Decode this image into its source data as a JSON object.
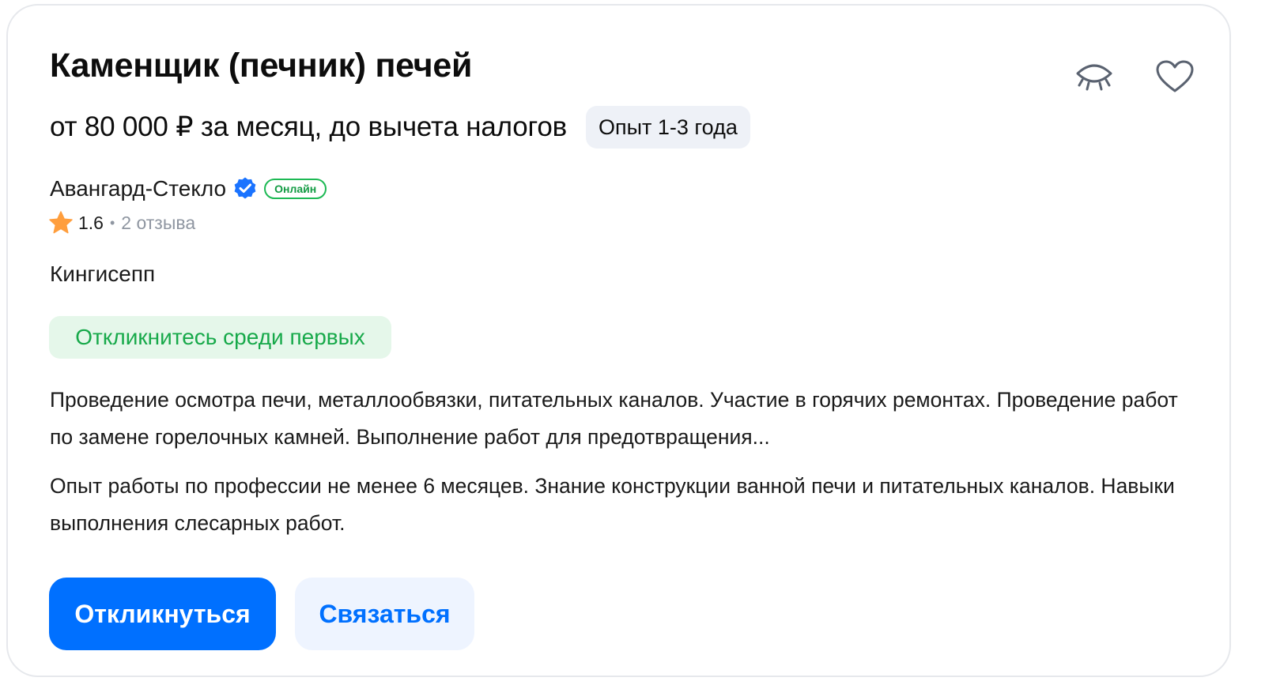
{
  "vacancy": {
    "title": "Каменщик (печник) печей",
    "salary": "от 80 000 ₽ за месяц, до вычета налогов",
    "experience_badge": "Опыт 1-3 года"
  },
  "actions": {
    "hide_icon": "eye-closed-icon",
    "favorite_icon": "heart-icon"
  },
  "company": {
    "name": "Авангард-Стекло",
    "verified_icon": "verified-check-icon",
    "online_badge": "Онлайн",
    "rating": "1.6",
    "separator": "•",
    "reviews": "2 отзыва"
  },
  "city": "Кингисепп",
  "highlight_badge": "Откликнитесь среди первых",
  "description": {
    "responsibilities": "Проведение осмотра печи, металлообвязки, питательных каналов. Участие в горячих ремонтах. Проведение работ по замене горелочных камней. Выполнение работ для предотвращения...",
    "requirements": "Опыт работы по профессии не менее 6 месяцев. Знание конструкции ванной печи и питательных каналов. Навыки выполнения слесарных работ."
  },
  "buttons": {
    "respond": "Откликнуться",
    "contact": "Связаться"
  },
  "colors": {
    "primary": "#0070ff",
    "success": "#17a94a",
    "star": "#ff9e3d",
    "muted": "#8f96a1"
  }
}
